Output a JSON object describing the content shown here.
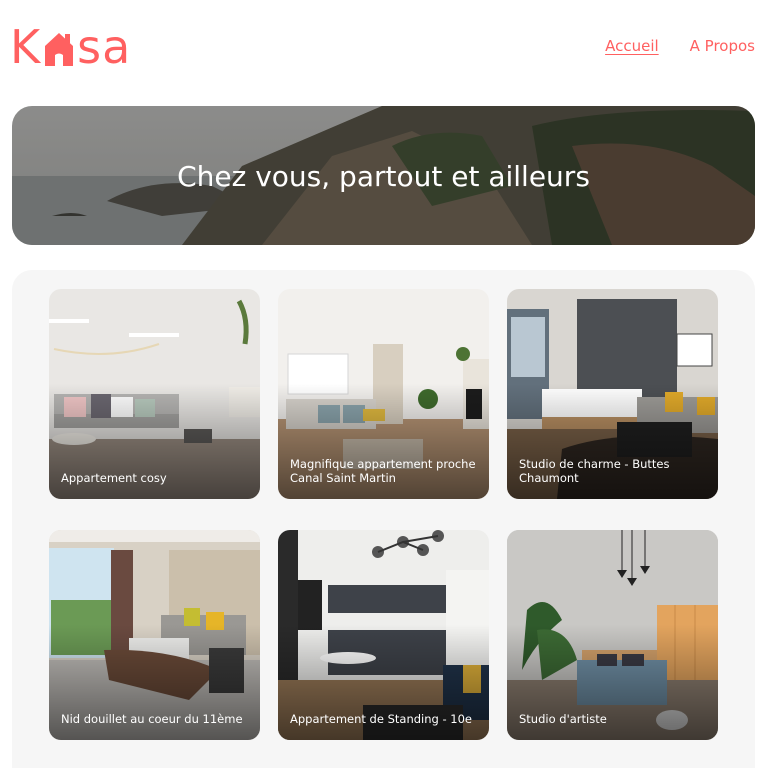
{
  "brand": {
    "logo_left": "K",
    "logo_right": "sa",
    "logo_icon": "house-icon",
    "accent_color": "#FF6060"
  },
  "nav": {
    "home": "Accueil",
    "about": "A Propos"
  },
  "banner": {
    "title": "Chez vous, partout et ailleurs"
  },
  "listings": [
    {
      "title": "Appartement cosy"
    },
    {
      "title": "Magnifique appartement proche Canal Saint Martin"
    },
    {
      "title": "Studio de charme - Buttes Chaumont"
    },
    {
      "title": "Nid douillet au coeur du 11ème"
    },
    {
      "title": "Appartement de Standing - 10e"
    },
    {
      "title": "Studio d'artiste"
    }
  ]
}
